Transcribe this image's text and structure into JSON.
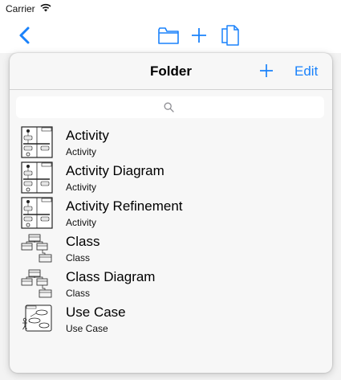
{
  "status_bar": {
    "carrier": "Carrier"
  },
  "toolbar": {
    "icons": [
      "chevron-left-icon",
      "folder-icon",
      "plus-icon",
      "documents-icon"
    ],
    "accent_color": "#1a82fb"
  },
  "popover": {
    "title": "Folder",
    "edit_label": "Edit",
    "search": {
      "placeholder": "",
      "value": ""
    },
    "items": [
      {
        "title": "Activity",
        "subtitle": "Activity",
        "icon": "activity-diagram-icon"
      },
      {
        "title": "Activity Diagram",
        "subtitle": "Activity",
        "icon": "activity-diagram-icon"
      },
      {
        "title": "Activity Refinement",
        "subtitle": "Activity",
        "icon": "activity-diagram-icon"
      },
      {
        "title": "Class",
        "subtitle": "Class",
        "icon": "class-diagram-icon"
      },
      {
        "title": "Class Diagram",
        "subtitle": "Class",
        "icon": "class-diagram-icon"
      },
      {
        "title": "Use Case",
        "subtitle": "Use Case",
        "icon": "use-case-diagram-icon"
      }
    ]
  }
}
